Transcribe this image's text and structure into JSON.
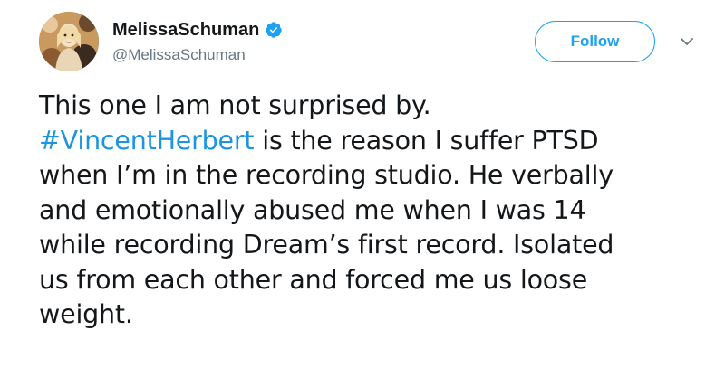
{
  "user": {
    "display_name": "MelissaSchuman",
    "handle": "@MelissaSchuman",
    "verified": true
  },
  "header": {
    "follow_label": "Follow"
  },
  "tweet": {
    "lines": [
      "This one I am not surprised by.",
      " is the reason I suffer PTSD",
      "when I’m in the recording studio. He verbally",
      "and emotionally abused me when I was 14",
      "while recording Dream’s first record. Isolated",
      "us from each other and forced me us loose",
      "weight."
    ],
    "hashtag": "#VincentHerbert"
  },
  "colors": {
    "accent": "#1da1f2",
    "hashtag": "#1c94e0",
    "text": "#14171a",
    "secondary": "#657786"
  },
  "icons": {
    "verified": "verified-badge-icon",
    "caret": "chevron-down-icon"
  }
}
